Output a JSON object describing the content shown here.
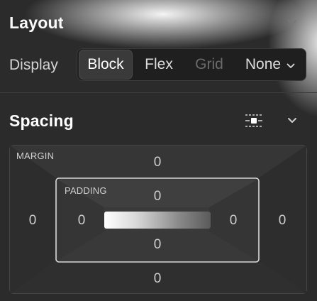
{
  "layout": {
    "title": "Layout",
    "display": {
      "label": "Display",
      "options": [
        "Block",
        "Flex",
        "Grid",
        "None"
      ],
      "selected": "Block",
      "disabled": [
        "Grid"
      ]
    }
  },
  "spacing": {
    "title": "Spacing",
    "margin": {
      "label": "MARGIN",
      "top": "0",
      "right": "0",
      "bottom": "0",
      "left": "0"
    },
    "padding": {
      "label": "PADDING",
      "top": "0",
      "right": "0",
      "bottom": "0",
      "left": "0"
    }
  },
  "icons": {
    "collapse": "chevron-down-icon",
    "spacing_link": "spacing-link-icon",
    "dropdown": "chevron-down-icon"
  },
  "colors": {
    "panel_bg": "#2b2b2b",
    "segment_bg": "#1f1f1f",
    "active_segment": "#3a3a3a",
    "disabled_text": "#6a6a6a"
  }
}
